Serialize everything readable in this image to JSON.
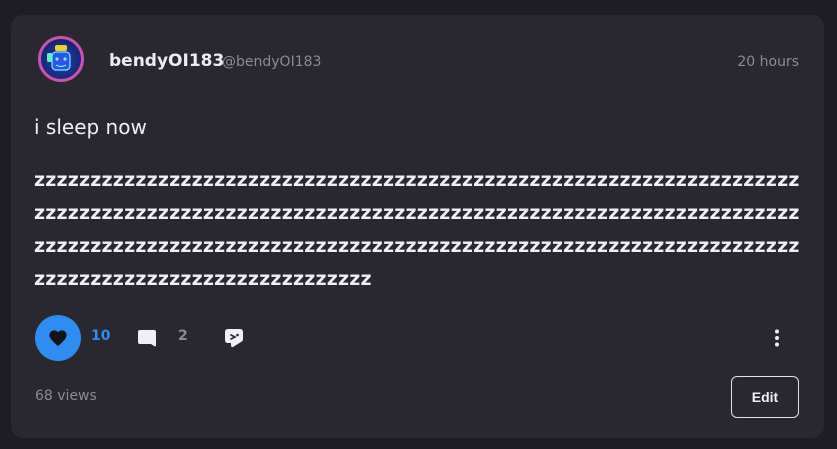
{
  "post": {
    "author": {
      "display_name": "bendyOI183",
      "handle": "@bendyOI183",
      "avatar_icon": "avatar-icon"
    },
    "timestamp": "20 hours",
    "title": "i sleep now",
    "body": "zzzzzzzzzzzzzzzzzzzzzzzzzzzzzzzzzzzzzzzzzzzzzzzzzzzzzzzzzzzzzzzzzzzzzzzzzzzzzzzzzzzzzzzzzzzzzzzzzzzzzzzzzzzzzzzzzzzzzzzzzzzzzzzzzzzzzzzzzzzzzzzzzzzzzzzzzzzzzzzzzzzzzzzzzzzzzzzzzzzzzzzzzzzzzzzzzzzzzzzzzzzzzzzzzzzzzzzzzzzzzzzzzzzzzzzzzz",
    "actions": {
      "like_count": "10",
      "comment_count": "2",
      "like_icon": "heart-icon",
      "comment_icon": "comment-icon",
      "share_icon": "share-icon",
      "more_icon": "more-vertical-icon"
    },
    "views": "68 views",
    "edit_label": "Edit"
  },
  "colors": {
    "background": "#1e1d23",
    "card": "#29272f",
    "accent": "#2f8df0",
    "muted_text": "#8d8a97",
    "primary_text": "#f0eff4",
    "avatar_ring": "#c653b0"
  }
}
